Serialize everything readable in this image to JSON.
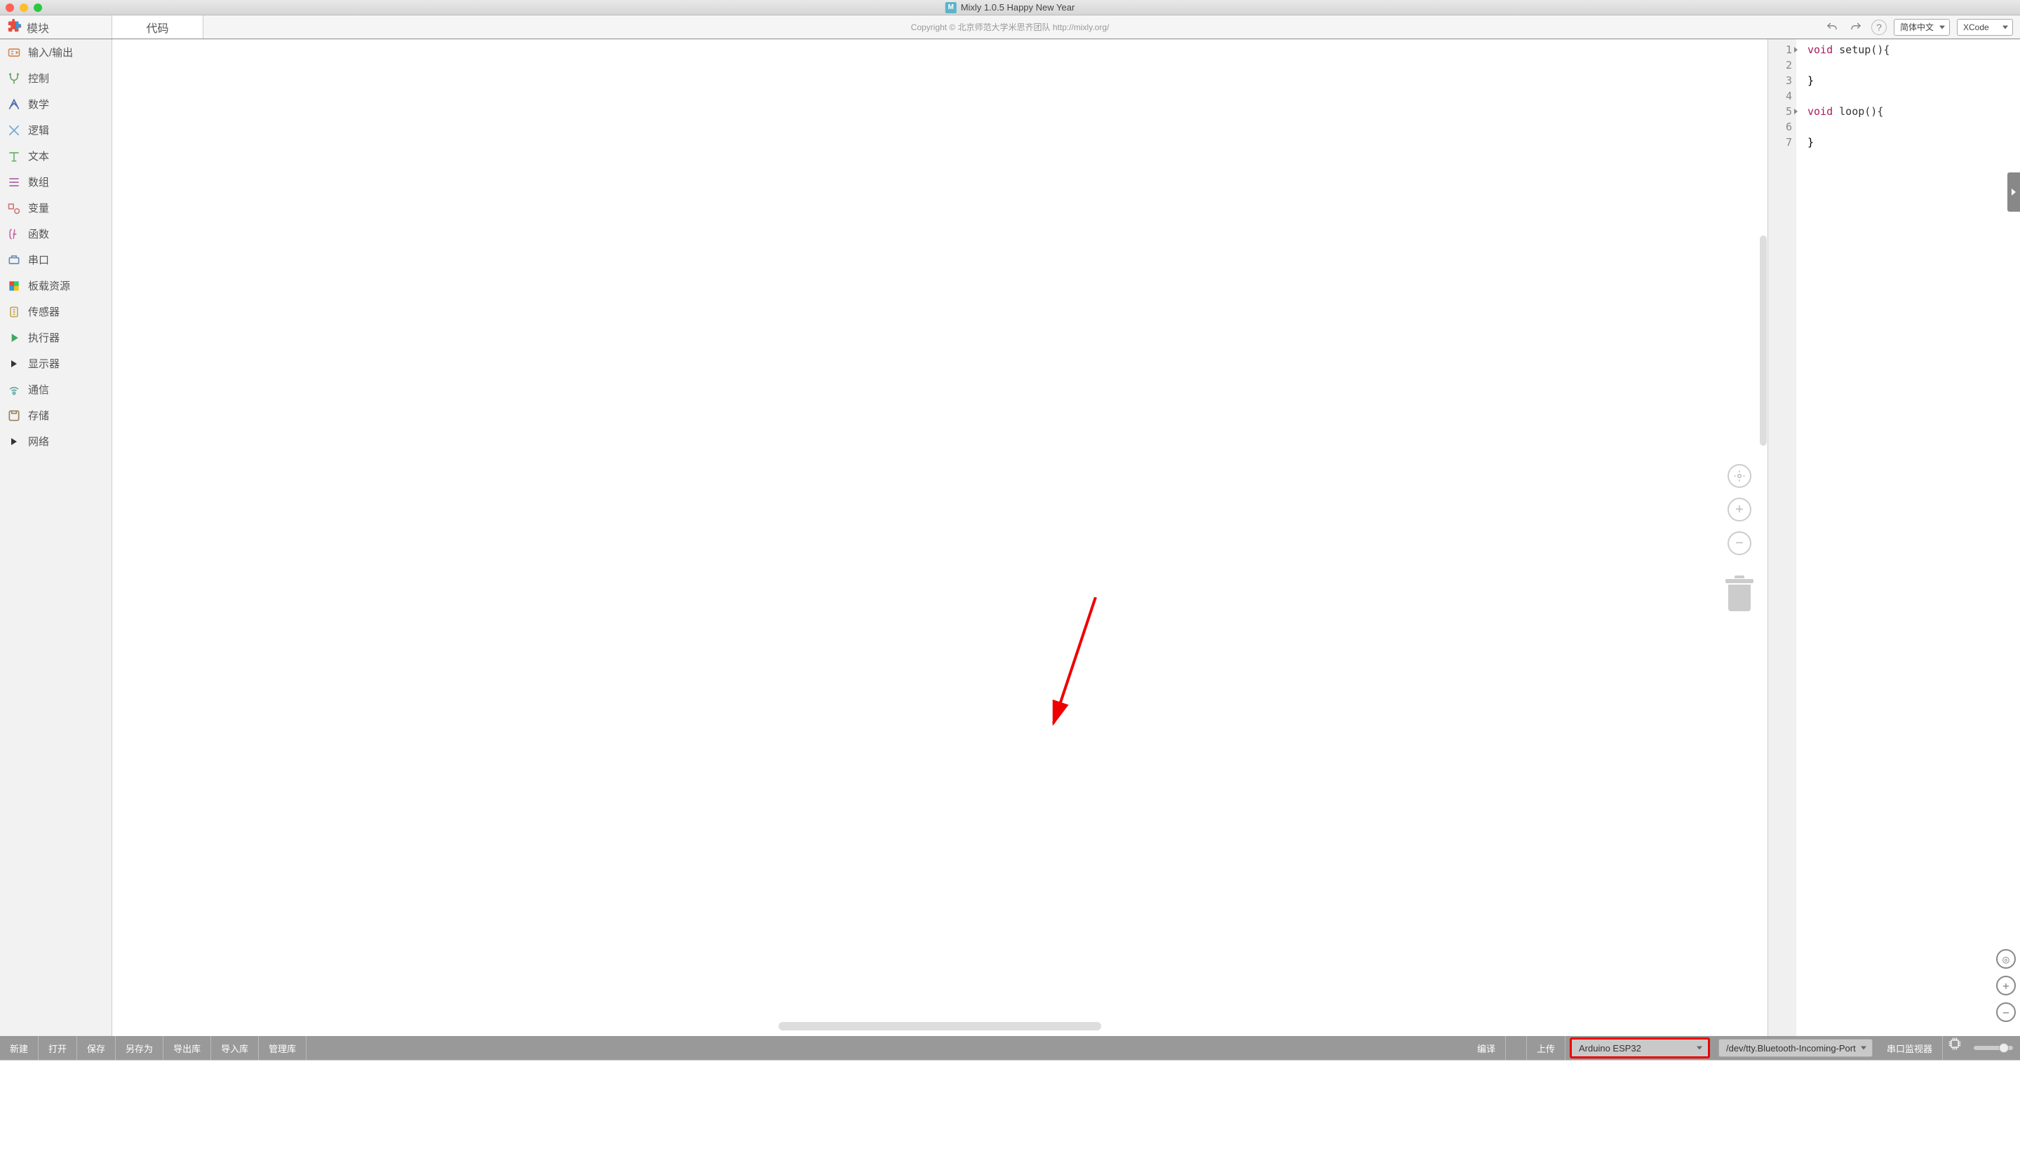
{
  "titlebar": {
    "title": "Mixly 1.0.5 Happy New Year"
  },
  "header": {
    "module_label": "模块",
    "code_tab": "代码",
    "copyright": "Copyright © 北京师范大学米思齐团队 http://mixly.org/",
    "lang_select": "简体中文",
    "theme_select": "XCode"
  },
  "sidebar": {
    "items": [
      {
        "label": "输入/输出",
        "color": "#d28c5a"
      },
      {
        "label": "控制",
        "color": "#6ca36c"
      },
      {
        "label": "数学",
        "color": "#4f6db3"
      },
      {
        "label": "逻辑",
        "color": "#6aa7d6"
      },
      {
        "label": "文本",
        "color": "#6bb36b"
      },
      {
        "label": "数组",
        "color": "#b06aa7"
      },
      {
        "label": "变量",
        "color": "#d07a7a"
      },
      {
        "label": "函数",
        "color": "#c96aa0"
      },
      {
        "label": "串口",
        "color": "#6a8fb3"
      },
      {
        "label": "板载资源",
        "color": "#2a8f3a"
      },
      {
        "label": "传感器",
        "color": "#c7a759"
      },
      {
        "label": "执行器",
        "color": "#3fa85f"
      },
      {
        "label": "显示器",
        "color": "#333333"
      },
      {
        "label": "通信",
        "color": "#5aa8a0"
      },
      {
        "label": "存储",
        "color": "#9a7f5a"
      },
      {
        "label": "网络",
        "color": "#333333"
      }
    ]
  },
  "code": {
    "lines": [
      "1",
      "2",
      "3",
      "4",
      "5",
      "6",
      "7"
    ],
    "content": {
      "l1a": "void",
      "l1b": " setup(){",
      "l2": "",
      "l3": "}",
      "l4": "",
      "l5a": "void",
      "l5b": " loop(){",
      "l6": "",
      "l7": "}"
    }
  },
  "toolbar": {
    "new": "新建",
    "open": "打开",
    "save": "保存",
    "saveas": "另存为",
    "exportlib": "导出库",
    "importlib": "导入库",
    "managelib": "管理库",
    "compile": "编译",
    "upload": "上传",
    "board": "Arduino ESP32",
    "port": "/dev/tty.Bluetooth-Incoming-Port",
    "serial_monitor": "串口监视器"
  },
  "annotation": {
    "highlighted_element": "board-select"
  }
}
